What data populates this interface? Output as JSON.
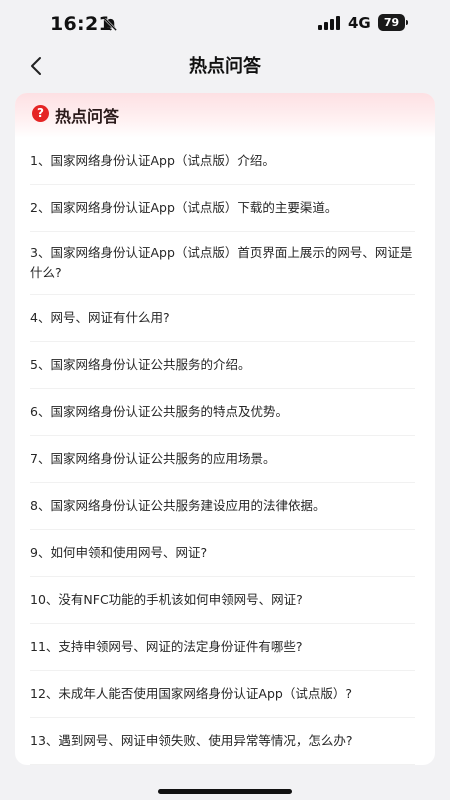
{
  "status_bar": {
    "time": "16:21",
    "network": "4G",
    "battery": "79"
  },
  "nav": {
    "title": "热点问答"
  },
  "card": {
    "title": "热点问答",
    "help_icon_glyph": "?"
  },
  "faq": [
    "1、国家网络身份认证App（试点版）介绍。",
    "2、国家网络身份认证App（试点版）下载的主要渠道。",
    "3、国家网络身份认证App（试点版）首页界面上展示的网号、网证是什么?",
    "4、网号、网证有什么用?",
    "5、国家网络身份认证公共服务的介绍。",
    "6、国家网络身份认证公共服务的特点及优势。",
    "7、国家网络身份认证公共服务的应用场景。",
    "8、国家网络身份认证公共服务建设应用的法律依据。",
    "9、如何申领和使用网号、网证?",
    "10、没有NFC功能的手机该如何申领网号、网证?",
    "11、支持申领网号、网证的法定身份证件有哪些?",
    "12、未成年人能否使用国家网络身份认证App（试点版）?",
    "13、遇到网号、网证申领失败、使用异常等情况，怎么办?"
  ],
  "colors": {
    "accent_red": "#e52525",
    "header_gradient": "#fde0e3",
    "page_background": "#f2f2f4"
  }
}
